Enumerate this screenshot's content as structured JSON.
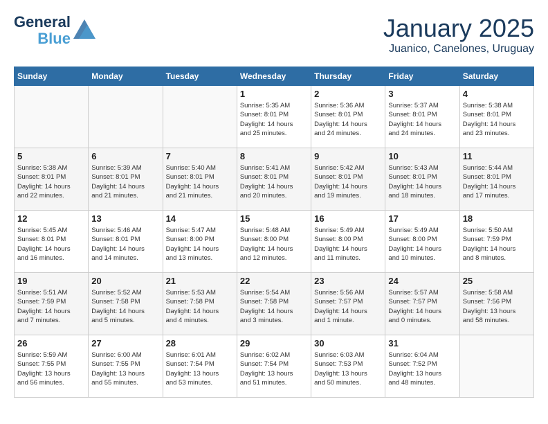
{
  "header": {
    "logo_general": "General",
    "logo_blue": "Blue",
    "month": "January 2025",
    "location": "Juanico, Canelones, Uruguay"
  },
  "days_of_week": [
    "Sunday",
    "Monday",
    "Tuesday",
    "Wednesday",
    "Thursday",
    "Friday",
    "Saturday"
  ],
  "weeks": [
    [
      {
        "day": "",
        "info": ""
      },
      {
        "day": "",
        "info": ""
      },
      {
        "day": "",
        "info": ""
      },
      {
        "day": "1",
        "info": "Sunrise: 5:35 AM\nSunset: 8:01 PM\nDaylight: 14 hours\nand 25 minutes."
      },
      {
        "day": "2",
        "info": "Sunrise: 5:36 AM\nSunset: 8:01 PM\nDaylight: 14 hours\nand 24 minutes."
      },
      {
        "day": "3",
        "info": "Sunrise: 5:37 AM\nSunset: 8:01 PM\nDaylight: 14 hours\nand 24 minutes."
      },
      {
        "day": "4",
        "info": "Sunrise: 5:38 AM\nSunset: 8:01 PM\nDaylight: 14 hours\nand 23 minutes."
      }
    ],
    [
      {
        "day": "5",
        "info": "Sunrise: 5:38 AM\nSunset: 8:01 PM\nDaylight: 14 hours\nand 22 minutes."
      },
      {
        "day": "6",
        "info": "Sunrise: 5:39 AM\nSunset: 8:01 PM\nDaylight: 14 hours\nand 21 minutes."
      },
      {
        "day": "7",
        "info": "Sunrise: 5:40 AM\nSunset: 8:01 PM\nDaylight: 14 hours\nand 21 minutes."
      },
      {
        "day": "8",
        "info": "Sunrise: 5:41 AM\nSunset: 8:01 PM\nDaylight: 14 hours\nand 20 minutes."
      },
      {
        "day": "9",
        "info": "Sunrise: 5:42 AM\nSunset: 8:01 PM\nDaylight: 14 hours\nand 19 minutes."
      },
      {
        "day": "10",
        "info": "Sunrise: 5:43 AM\nSunset: 8:01 PM\nDaylight: 14 hours\nand 18 minutes."
      },
      {
        "day": "11",
        "info": "Sunrise: 5:44 AM\nSunset: 8:01 PM\nDaylight: 14 hours\nand 17 minutes."
      }
    ],
    [
      {
        "day": "12",
        "info": "Sunrise: 5:45 AM\nSunset: 8:01 PM\nDaylight: 14 hours\nand 16 minutes."
      },
      {
        "day": "13",
        "info": "Sunrise: 5:46 AM\nSunset: 8:01 PM\nDaylight: 14 hours\nand 14 minutes."
      },
      {
        "day": "14",
        "info": "Sunrise: 5:47 AM\nSunset: 8:00 PM\nDaylight: 14 hours\nand 13 minutes."
      },
      {
        "day": "15",
        "info": "Sunrise: 5:48 AM\nSunset: 8:00 PM\nDaylight: 14 hours\nand 12 minutes."
      },
      {
        "day": "16",
        "info": "Sunrise: 5:49 AM\nSunset: 8:00 PM\nDaylight: 14 hours\nand 11 minutes."
      },
      {
        "day": "17",
        "info": "Sunrise: 5:49 AM\nSunset: 8:00 PM\nDaylight: 14 hours\nand 10 minutes."
      },
      {
        "day": "18",
        "info": "Sunrise: 5:50 AM\nSunset: 7:59 PM\nDaylight: 14 hours\nand 8 minutes."
      }
    ],
    [
      {
        "day": "19",
        "info": "Sunrise: 5:51 AM\nSunset: 7:59 PM\nDaylight: 14 hours\nand 7 minutes."
      },
      {
        "day": "20",
        "info": "Sunrise: 5:52 AM\nSunset: 7:58 PM\nDaylight: 14 hours\nand 5 minutes."
      },
      {
        "day": "21",
        "info": "Sunrise: 5:53 AM\nSunset: 7:58 PM\nDaylight: 14 hours\nand 4 minutes."
      },
      {
        "day": "22",
        "info": "Sunrise: 5:54 AM\nSunset: 7:58 PM\nDaylight: 14 hours\nand 3 minutes."
      },
      {
        "day": "23",
        "info": "Sunrise: 5:56 AM\nSunset: 7:57 PM\nDaylight: 14 hours\nand 1 minute."
      },
      {
        "day": "24",
        "info": "Sunrise: 5:57 AM\nSunset: 7:57 PM\nDaylight: 14 hours\nand 0 minutes."
      },
      {
        "day": "25",
        "info": "Sunrise: 5:58 AM\nSunset: 7:56 PM\nDaylight: 13 hours\nand 58 minutes."
      }
    ],
    [
      {
        "day": "26",
        "info": "Sunrise: 5:59 AM\nSunset: 7:55 PM\nDaylight: 13 hours\nand 56 minutes."
      },
      {
        "day": "27",
        "info": "Sunrise: 6:00 AM\nSunset: 7:55 PM\nDaylight: 13 hours\nand 55 minutes."
      },
      {
        "day": "28",
        "info": "Sunrise: 6:01 AM\nSunset: 7:54 PM\nDaylight: 13 hours\nand 53 minutes."
      },
      {
        "day": "29",
        "info": "Sunrise: 6:02 AM\nSunset: 7:54 PM\nDaylight: 13 hours\nand 51 minutes."
      },
      {
        "day": "30",
        "info": "Sunrise: 6:03 AM\nSunset: 7:53 PM\nDaylight: 13 hours\nand 50 minutes."
      },
      {
        "day": "31",
        "info": "Sunrise: 6:04 AM\nSunset: 7:52 PM\nDaylight: 13 hours\nand 48 minutes."
      },
      {
        "day": "",
        "info": ""
      }
    ]
  ]
}
